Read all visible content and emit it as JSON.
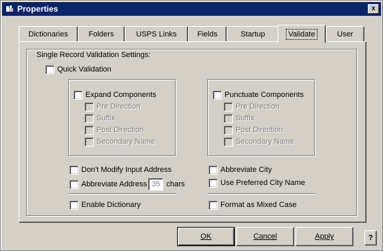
{
  "window": {
    "title": "Properties",
    "close_glyph": "x"
  },
  "tabs": [
    {
      "label": "Dictionaries",
      "active": false
    },
    {
      "label": "Folders",
      "active": false
    },
    {
      "label": "USPS Links",
      "active": false
    },
    {
      "label": "Fields",
      "active": false
    },
    {
      "label": "Startup",
      "active": false
    },
    {
      "label": "Validate",
      "active": true
    },
    {
      "label": "User",
      "active": false
    }
  ],
  "validate": {
    "group_label": "Single Record Validation Settings:",
    "quick_validation": "Quick Validation",
    "expand": {
      "label": "Expand Components",
      "items": [
        "Pre Direction",
        "Suffix",
        "Post Direction",
        "Secondary Name"
      ]
    },
    "punctuate": {
      "label": "Punctuate Components",
      "items": [
        "Pre Direction",
        "Suffix",
        "Post Direction",
        "Secondary Name"
      ]
    },
    "dont_modify": "Don't Modify Input Address",
    "abbreviate_address": "Abbreviate Address",
    "abbreviate_chars_value": "35",
    "abbreviate_chars_unit": "chars",
    "abbreviate_city": "Abbreviate City",
    "preferred_city": "Use Preferred City Name",
    "enable_dictionary": "Enable Dictionary",
    "mixed_case": "Format as Mixed Case"
  },
  "buttons": {
    "ok": "OK",
    "cancel": "Cancel",
    "apply": "Apply",
    "help": "?"
  }
}
